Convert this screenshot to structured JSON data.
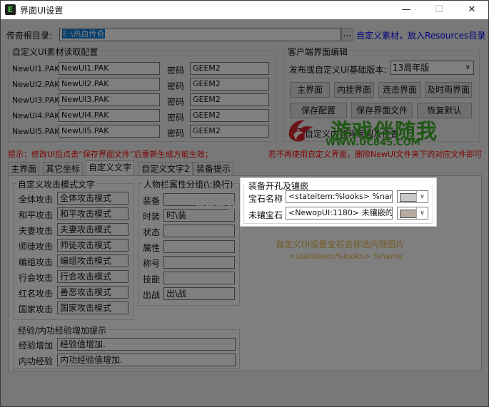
{
  "window": {
    "title": "界面UI设置",
    "app_icon": "E",
    "minimize_glyph": "—",
    "maximize_glyph": "☐",
    "close_glyph": "✕"
  },
  "root_dir": {
    "label": "传奇根目录:",
    "value": "E:\\热血传奇",
    "browse_label": "...",
    "hint": "自定义素材，放入Resources目录"
  },
  "material_config": {
    "title": "自定义UI素材读取配置",
    "password_label": "密码",
    "rows": [
      {
        "label": "NewUI1.PAK",
        "file": "NewUI1.PAK",
        "password": "GEEM2"
      },
      {
        "label": "NewUI2.PAK",
        "file": "NewUI2.PAK",
        "password": "GEEM2"
      },
      {
        "label": "NewUI3.PAK",
        "file": "NewUI3.PAK",
        "password": "GEEM2"
      },
      {
        "label": "NewUI4.PAK",
        "file": "NewUI4.PAK",
        "password": "GEEM2"
      },
      {
        "label": "NewUI5.PAK",
        "file": "NewUI5.PAK",
        "password": "GEEM2"
      }
    ]
  },
  "client_edit": {
    "title": "客户端界面编辑",
    "version_label": "发布或自定义UI基础版本:",
    "version_value": "13周年版",
    "buttons": [
      "主界面",
      "内挂界面",
      "连击界面",
      "及时雨界面",
      "保存配置",
      "保存界面文件",
      "恢复默认"
    ],
    "checkbox_label": "自定义内挂背景图及位置"
  },
  "warning": {
    "left": "提示：修改UI后点击“保存界面文件”后重新生成方能生效；",
    "right": "若不再使用自定义界面，删除NewUI文件夹下的对应文件即可"
  },
  "tabs": [
    "主界面",
    "其它坐标",
    "自定义文字",
    "自定义文字2",
    "装备提示"
  ],
  "active_tab": 2,
  "attack_mode": {
    "title": "自定义攻击模式文字",
    "rows": [
      {
        "label": "全体攻击",
        "value": "全体攻击模式"
      },
      {
        "label": "和平攻击",
        "value": "和平攻击模式"
      },
      {
        "label": "夫妻攻击",
        "value": "夫妻攻击模式"
      },
      {
        "label": "师徒攻击",
        "value": "师徒攻击模式"
      },
      {
        "label": "编组攻击",
        "value": "编组攻击模式"
      },
      {
        "label": "行会攻击",
        "value": "行会攻击模式"
      },
      {
        "label": "红名攻击",
        "value": "善恶攻击模式"
      },
      {
        "label": "国家攻击",
        "value": "国家攻击模式"
      }
    ]
  },
  "attr_group": {
    "title": "人物栏属性分组(\\:换行)",
    "rows": [
      {
        "label": "装备",
        "value": ""
      },
      {
        "label": "时装",
        "value": "时\\装"
      },
      {
        "label": "状态",
        "value": ""
      },
      {
        "label": "属性",
        "value": ""
      },
      {
        "label": "称号",
        "value": ""
      },
      {
        "label": "技能",
        "value": ""
      },
      {
        "label": "出战",
        "value": "出\\战"
      }
    ]
  },
  "gem_panel": {
    "title": "装备开孔及镶嵌",
    "rows": [
      {
        "label": "宝石名称",
        "value": "<stateitem:%looks> %name",
        "color": "#c8c8c8"
      },
      {
        "label": "未镶宝石",
        "value": "<NewopUI:1180> 未镶嵌的宝",
        "color": "#b4aaa0"
      }
    ],
    "dropdown_glyph": "∨"
  },
  "gem_hint": {
    "line1": "自定义UI设置宝石名称选内观图片",
    "line2": "<stateitem:%looks> %name"
  },
  "exp": {
    "title": "经验/内功经验增加提示",
    "rows": [
      {
        "label": "经验增加",
        "value": "经验值增加."
      },
      {
        "label": "内功经验",
        "value": "内功经验值增加."
      }
    ]
  },
  "watermark": {
    "brand": "游戏伴随我",
    "url": "WWW.UC845.COM",
    "left_text": "www.ge"
  },
  "colors": {
    "warning_red": "#ff0000",
    "hint_blue": "#0000ff",
    "gem_hint_gold": "#e6b84c",
    "watermark_green": "#3fae2a",
    "watermark_red": "#d9262e"
  }
}
